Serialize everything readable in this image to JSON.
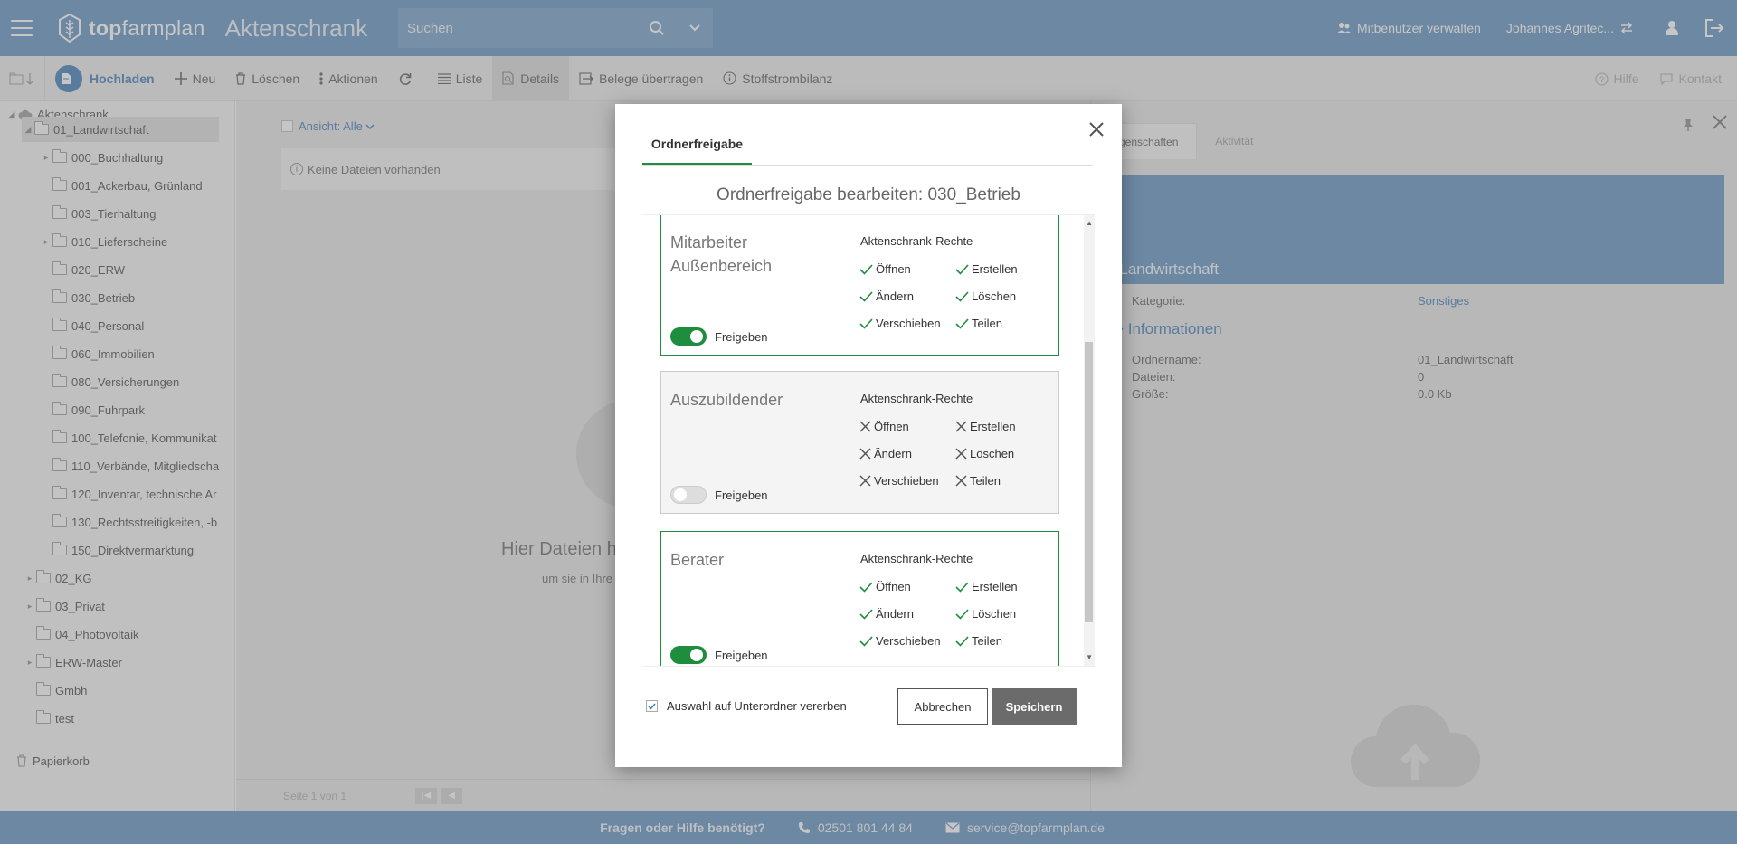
{
  "header": {
    "logo_bold": "top",
    "logo_light": "farmplan",
    "app_title": "Aktenschrank",
    "search_placeholder": "Suchen",
    "manage_users": "Mitbenutzer verwalten",
    "user_name": "Johannes Agritec...",
    "icons": [
      "menu-icon",
      "search-icon",
      "chevron-down-icon",
      "users-icon",
      "switch-icon",
      "user-icon",
      "logout-icon"
    ]
  },
  "toolbar": {
    "upload": "Hochladen",
    "new": "Neu",
    "delete": "Löschen",
    "actions": "Aktionen",
    "list": "Liste",
    "details": "Details",
    "transfer": "Belege übertragen",
    "balance": "Stoffstrombilanz",
    "help": "Hilfe",
    "contact": "Kontakt"
  },
  "sidebar": {
    "root": "Aktenschrank",
    "items": [
      {
        "label": "01_Landwirtschaft",
        "level": 1
      },
      {
        "label": "000_Buchhaltung",
        "level": 2
      },
      {
        "label": "001_Ackerbau, Grünland",
        "level": 2
      },
      {
        "label": "003_Tierhaltung",
        "level": 2
      },
      {
        "label": "010_Lieferscheine",
        "level": 2
      },
      {
        "label": "020_ERW",
        "level": 2
      },
      {
        "label": "030_Betrieb",
        "level": 2
      },
      {
        "label": "040_Personal",
        "level": 2
      },
      {
        "label": "060_Immobilien",
        "level": 2
      },
      {
        "label": "080_Versicherungen",
        "level": 2
      },
      {
        "label": "090_Fuhrpark",
        "level": 2
      },
      {
        "label": "100_Telefonie, Kommunikat",
        "level": 2
      },
      {
        "label": "110_Verbände, Mitgliedscha",
        "level": 2
      },
      {
        "label": "120_Inventar, technische Ar",
        "level": 2
      },
      {
        "label": "130_Rechtsstreitigkeiten, -b",
        "level": 2
      },
      {
        "label": "150_Direktvermarktung",
        "level": 2
      },
      {
        "label": "02_KG",
        "level": 1
      },
      {
        "label": "03_Privat",
        "level": 1
      },
      {
        "label": "04_Photovoltaik",
        "level": 1
      },
      {
        "label": "ERW-Mäster",
        "level": 1
      },
      {
        "label": "Gmbh",
        "level": 1
      },
      {
        "label": "test",
        "level": 1
      }
    ],
    "trash": "Papierkorb"
  },
  "middle": {
    "view_filter": "Ansicht: Alle",
    "empty_info": "Keine Dateien vorhanden",
    "drop_title": "Hier Dateien h",
    "drop_sub": "um sie in Ihre",
    "pagination": "Seite 1 von 1"
  },
  "right_panel": {
    "tab_properties": "genschaften",
    "tab_activity": "Aktivität",
    "folder_title": "01_Landwirtschaft",
    "category_label": "Kategorie:",
    "category_value": "Sonstiges",
    "section_title": "Informationen",
    "folder_name_label": "Ordnername:",
    "folder_name_value": "01_Landwirtschaft",
    "files_label": "Dateien:",
    "files_value": "0",
    "size_label": "Größe:",
    "size_value": "0.0 Kb"
  },
  "modal": {
    "tab": "Ordnerfreigabe",
    "title": "Ordnerfreigabe bearbeiten: 030_Betrieb",
    "rights_label": "Aktenschrank-Rechte",
    "share_label": "Freigeben",
    "rights_names": {
      "open": "Öffnen",
      "create": "Erstellen",
      "change": "Ändern",
      "delete": "Löschen",
      "move": "Verschieben",
      "share": "Teilen"
    },
    "roles": [
      {
        "name": "Mitarbeiter Außenbereich",
        "enabled": true
      },
      {
        "name": "Auszubildender",
        "enabled": false
      },
      {
        "name": "Berater",
        "enabled": true
      }
    ],
    "inherit_label": "Auswahl auf Unterordner vererben",
    "inherit_checked": true,
    "cancel": "Abbrechen",
    "save": "Speichern"
  },
  "footer": {
    "question": "Fragen oder Hilfe benötigt?",
    "phone": "02501 801 44 84",
    "email": "service@topfarmplan.de"
  },
  "colors": {
    "brand_blue": "#5b8fbf",
    "accent_green": "#1e8e3e",
    "link_blue": "#3a77b5"
  }
}
